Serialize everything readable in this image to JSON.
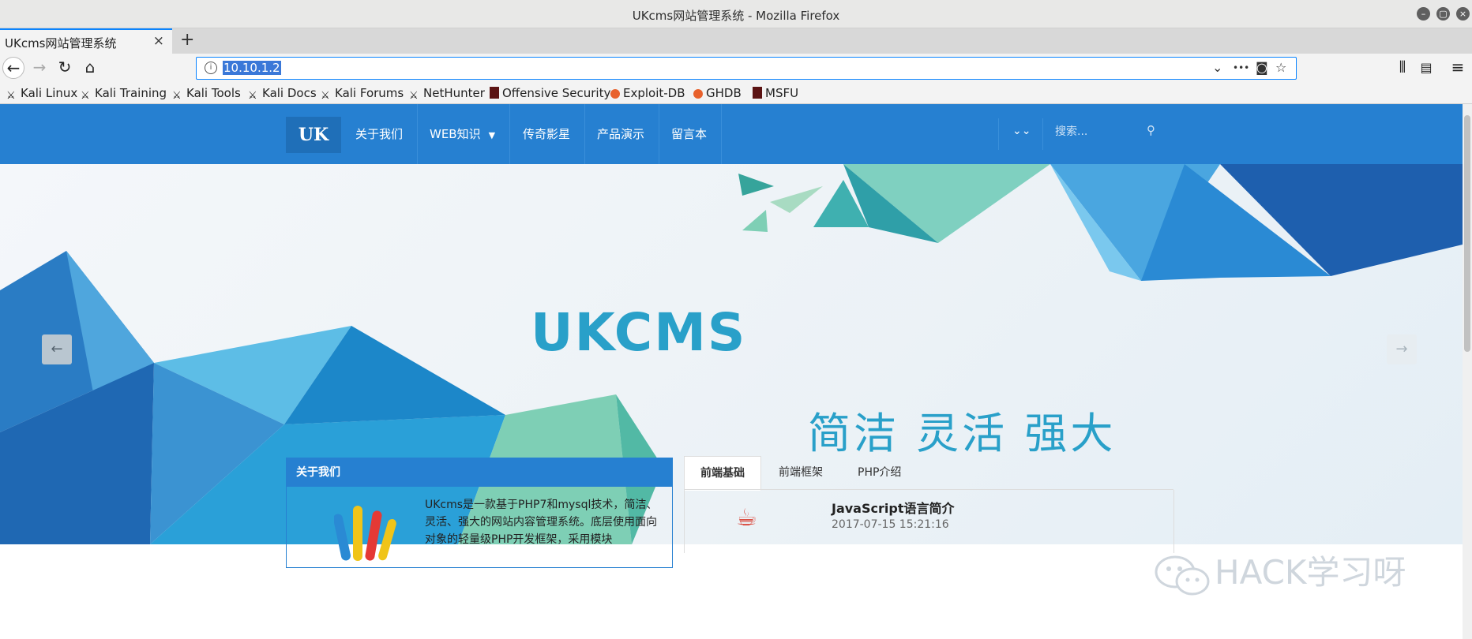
{
  "window": {
    "title": "UKcms网站管理系统 - Mozilla Firefox"
  },
  "tab": {
    "title": "UKcms网站管理系统",
    "close": "×",
    "newtab": "+"
  },
  "nav": {
    "back": "←",
    "forward": "→",
    "reload": "↻",
    "home": "⌂",
    "url": "10.10.1.2",
    "info": "i",
    "dropdown": "⌄",
    "more": "•••",
    "pocket": "◙",
    "star": "☆",
    "library": "⫴",
    "sidebar": "▤",
    "menu": "≡"
  },
  "bookmarks": [
    {
      "label": "Kali Linux",
      "icon": "kali-dragon-icon"
    },
    {
      "label": "Kali Training",
      "icon": "kali-dragon-icon"
    },
    {
      "label": "Kali Tools",
      "icon": "kali-dragon-icon"
    },
    {
      "label": "Kali Docs",
      "icon": "kali-dragon-icon"
    },
    {
      "label": "Kali Forums",
      "icon": "kali-dragon-icon"
    },
    {
      "label": "NetHunter",
      "icon": "kali-dragon-icon"
    },
    {
      "label": "Offensive Security",
      "icon": "offsec-icon"
    },
    {
      "label": "Exploit-DB",
      "icon": "exploitdb-icon"
    },
    {
      "label": "GHDB",
      "icon": "exploitdb-icon"
    },
    {
      "label": "MSFU",
      "icon": "offsec-icon"
    }
  ],
  "site": {
    "logo": "UK",
    "menu": [
      "关于我们",
      "WEB知识",
      "传奇影星",
      "产品演示",
      "留言本"
    ],
    "expand": "⌄⌄",
    "search_placeholder": "搜索...",
    "search_icon": "⚲",
    "hero": {
      "title": "UKCMS",
      "subtitle": "简洁 灵活 强大",
      "prev": "←",
      "next": "→"
    },
    "about": {
      "heading": "关于我们",
      "text": "UKcms是一款基于PHP7和mysql技术，简洁、灵活、强大的网站内容管理系统。底层使用面向对象的轻量级PHP开发框架，采用模块"
    },
    "tabs": [
      "前端基础",
      "前端框架",
      "PHP介绍"
    ],
    "article": {
      "title": "JavaScript语言简介",
      "date": "2017-07-15 15:21:16"
    }
  },
  "watermark": "HACK学习呀",
  "colors": {
    "nav_blue": "#2680d1",
    "hero_text": "#29a0c9",
    "url_focus": "#0a84ff"
  }
}
